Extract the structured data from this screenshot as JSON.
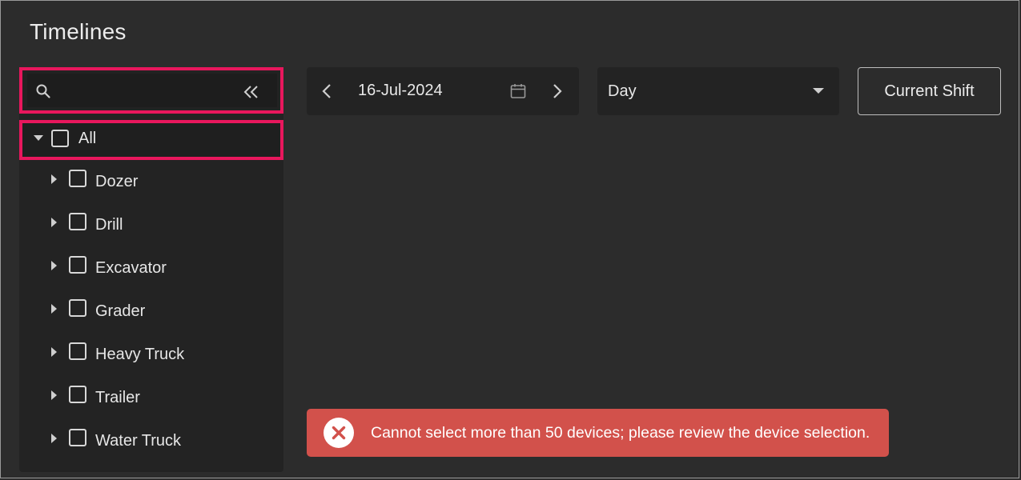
{
  "page": {
    "title": "Timelines"
  },
  "search": {
    "placeholder": "",
    "value": ""
  },
  "tree": {
    "root": {
      "label": "All",
      "checked": false,
      "expanded": true
    },
    "items": [
      {
        "label": "Dozer"
      },
      {
        "label": "Drill"
      },
      {
        "label": "Excavator"
      },
      {
        "label": "Grader"
      },
      {
        "label": "Heavy Truck"
      },
      {
        "label": "Trailer"
      },
      {
        "label": "Water Truck"
      }
    ]
  },
  "toolbar": {
    "date": "16-Jul-2024",
    "view": "Day",
    "shift_button": "Current Shift"
  },
  "toast": {
    "message": "Cannot select more than 50 devices; please review the device selection."
  },
  "icons": {
    "search": "search-icon",
    "collapse": "double-chevron-left-icon",
    "prev": "chevron-left-icon",
    "next": "chevron-right-icon",
    "calendar": "calendar-icon",
    "dropdown": "caret-down-icon",
    "error": "error-circle-icon"
  },
  "colors": {
    "background": "#2c2c2c",
    "panel": "#232323",
    "highlight": "#e8175d",
    "toast": "#d2514b"
  }
}
